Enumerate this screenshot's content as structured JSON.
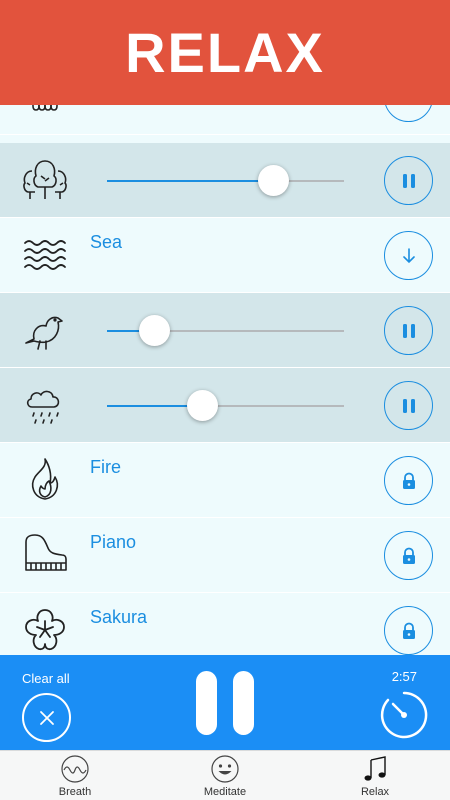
{
  "header": {
    "title": "RELAX"
  },
  "sounds": [
    {
      "name": "",
      "icon": "rain-shower-icon",
      "state": "download",
      "level": null
    },
    {
      "name": "",
      "icon": "trees-icon",
      "state": "playing",
      "level": 0.7
    },
    {
      "name": "Sea",
      "icon": "waves-icon",
      "state": "download",
      "level": null
    },
    {
      "name": "",
      "icon": "bird-icon",
      "state": "playing",
      "level": 0.2
    },
    {
      "name": "",
      "icon": "rain-cloud-icon",
      "state": "playing",
      "level": 0.4
    },
    {
      "name": "Fire",
      "icon": "fire-icon",
      "state": "locked",
      "level": null
    },
    {
      "name": "Piano",
      "icon": "piano-icon",
      "state": "locked",
      "level": null
    },
    {
      "name": "Sakura",
      "icon": "sakura-icon",
      "state": "locked",
      "level": null
    }
  ],
  "player": {
    "clear_label": "Clear all",
    "timer": "2:57"
  },
  "tabs": [
    {
      "label": "Breath",
      "icon": "breath-icon",
      "active": false
    },
    {
      "label": "Meditate",
      "icon": "smiley-icon",
      "active": false
    },
    {
      "label": "Relax",
      "icon": "music-note-icon",
      "active": true
    }
  ],
  "colors": {
    "header": "#e2533d",
    "accent": "#1b8ee0",
    "player": "#1b8ef5",
    "playing_row": "#d3e6ea",
    "idle_row": "#eefbfd"
  }
}
